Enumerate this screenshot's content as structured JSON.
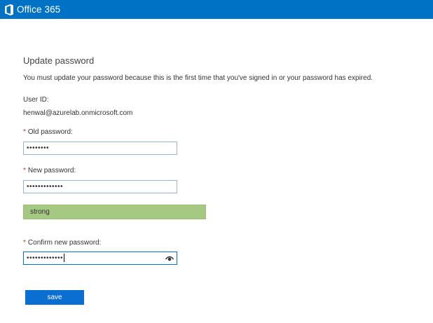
{
  "header": {
    "brand": "Office 365",
    "brand_color": "#0072c6"
  },
  "form": {
    "title": "Update password",
    "description": "You must update your password because this is the first time that you've signed in or your password has expired.",
    "user_id_label": "User ID:",
    "user_id_value": "henwal@azurelab.onmicrosoft.com",
    "required_marker": "*",
    "old_password": {
      "label": "Old password:",
      "masked_value": "••••••••"
    },
    "new_password": {
      "label": "New password:",
      "masked_value": "•••••••••••••"
    },
    "strength": {
      "label": "strong",
      "color": "#a5c882"
    },
    "confirm_password": {
      "label": "Confirm new password:",
      "masked_value": "•••••••••••••",
      "reveal_icon": "eye-icon"
    },
    "save_label": "save"
  }
}
